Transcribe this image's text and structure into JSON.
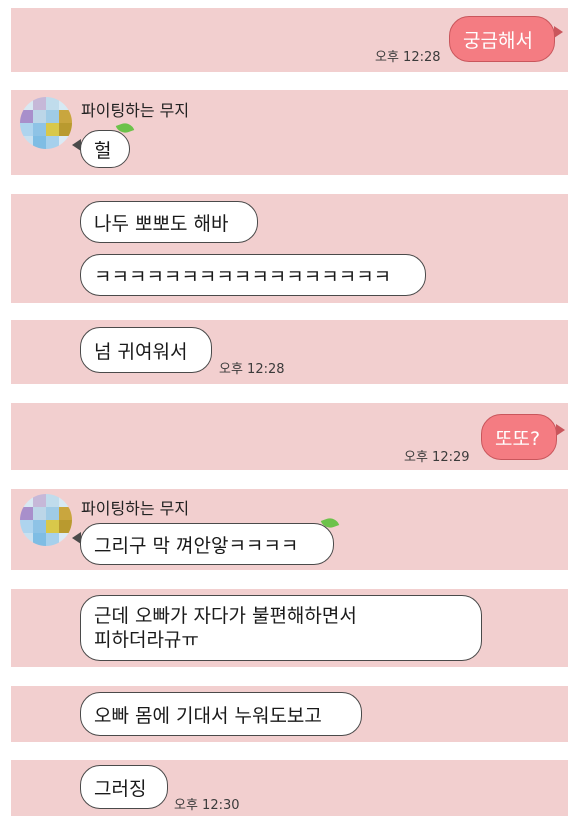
{
  "sender": {
    "name": "파이팅하는 무지"
  },
  "colors": {
    "strip_bg": "#f2cfcf",
    "my_bubble": "#f47c82",
    "their_bubble": "#ffffff"
  },
  "messages": [
    {
      "from": "me",
      "text": "궁금해서",
      "time": "오후 12:28"
    },
    {
      "from": "them",
      "text": "헐"
    },
    {
      "from": "them",
      "text": "나두 뽀뽀도 해바"
    },
    {
      "from": "them",
      "text": "ㅋㅋㅋㅋㅋㅋㅋㅋㅋㅋㅋㅋㅋㅋㅋㅋㅋ"
    },
    {
      "from": "them",
      "text": "넘 귀여워서",
      "time": "오후 12:28"
    },
    {
      "from": "me",
      "text": "또또?",
      "time": "오후 12:29"
    },
    {
      "from": "them",
      "text": "그리구 막 껴안앟ㅋㅋㅋㅋ"
    },
    {
      "from": "them",
      "lines": [
        "근데 오빠가 자다가 불편해하면서",
        "피하더라규ㅠ"
      ]
    },
    {
      "from": "them",
      "text": "오빠 몸에 기대서 누워도보고"
    },
    {
      "from": "them",
      "text": "그러징",
      "time": "오후 12:30"
    }
  ]
}
